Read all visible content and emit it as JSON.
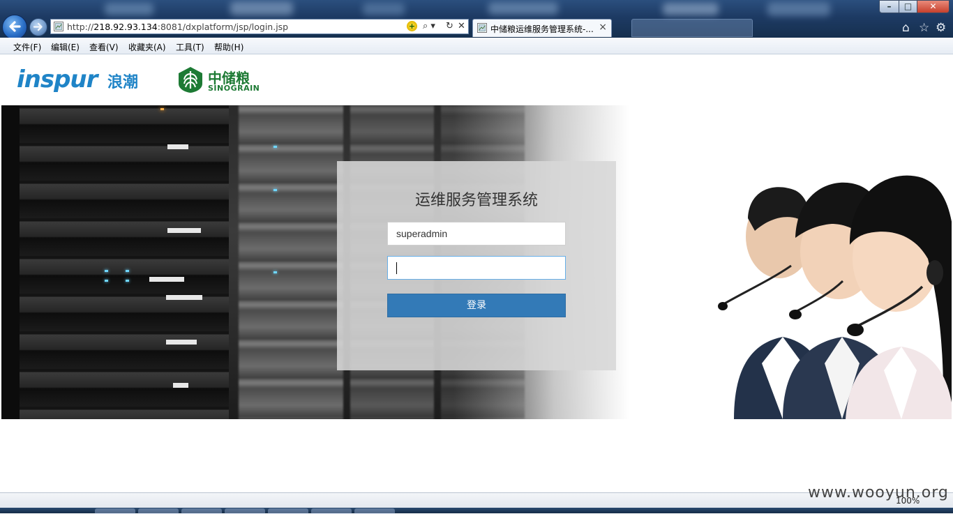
{
  "browser": {
    "url_prefix": "http://",
    "url_host": "218.92.93.134",
    "url_rest": ":8081/dxplatform/jsp/login.jsp",
    "tab_title": "中储粮运维服务管理系统-...",
    "tab_close": "×",
    "stop": "✕",
    "refresh": "↻",
    "search": "⌕ ▾",
    "compat": "+"
  },
  "window_controls": {
    "minimize": "–",
    "maximize": "□",
    "close": "✕"
  },
  "menu": [
    "文件(F)",
    "编辑(E)",
    "查看(V)",
    "收藏夹(A)",
    "工具(T)",
    "帮助(H)"
  ],
  "logos": {
    "inspur_en": "inspur",
    "inspur_cn": "浪潮",
    "sinograin_cn": "中储粮",
    "sinograin_en": "SINOGRAIN"
  },
  "login": {
    "title": "运维服务管理系统",
    "username_value": "superadmin",
    "password_value": "",
    "submit_label": "登录"
  },
  "status": {
    "zoom": "100%"
  },
  "watermark": "www.wooyun.org",
  "colors": {
    "primary_button": "#337ab7",
    "inspur_blue": "#1f84c7",
    "sinograin_green": "#1d7a34"
  }
}
